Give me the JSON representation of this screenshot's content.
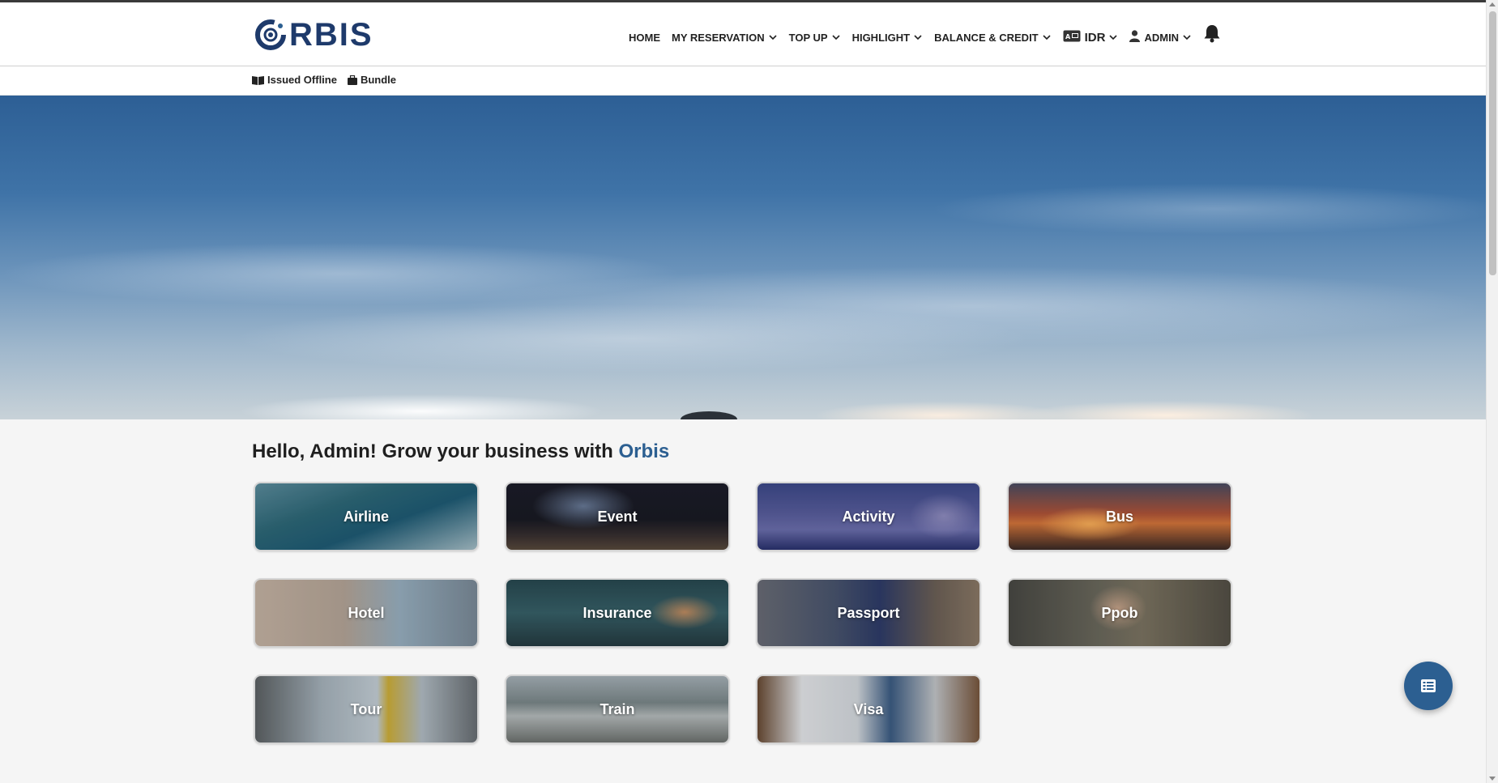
{
  "brand": {
    "name": "RBIS",
    "accent_color": "#2c5f91",
    "logo_color": "#1e3a6b"
  },
  "nav": {
    "home": "HOME",
    "my_reservation": "MY RESERVATION",
    "top_up": "TOP UP",
    "highlight": "HIGHLIGHT",
    "balance_credit": "BALANCE & CREDIT",
    "currency": "IDR",
    "user": "ADMIN"
  },
  "subnav": {
    "issued_offline": "Issued Offline",
    "bundle": "Bundle"
  },
  "greeting": {
    "prefix": "Hello, Admin! Grow your business with",
    "brand": "Orbis"
  },
  "products": [
    {
      "label": "Airline"
    },
    {
      "label": "Event"
    },
    {
      "label": "Activity"
    },
    {
      "label": "Bus"
    },
    {
      "label": "Hotel"
    },
    {
      "label": "Insurance"
    },
    {
      "label": "Passport"
    },
    {
      "label": "Ppob"
    },
    {
      "label": "Tour"
    },
    {
      "label": "Train"
    },
    {
      "label": "Visa"
    }
  ],
  "icons": {
    "issued_offline": "book-open-icon",
    "bundle": "briefcase-icon",
    "currency": "id-card-icon",
    "user": "user-icon",
    "notifications": "bell-icon",
    "fab": "list-icon"
  }
}
